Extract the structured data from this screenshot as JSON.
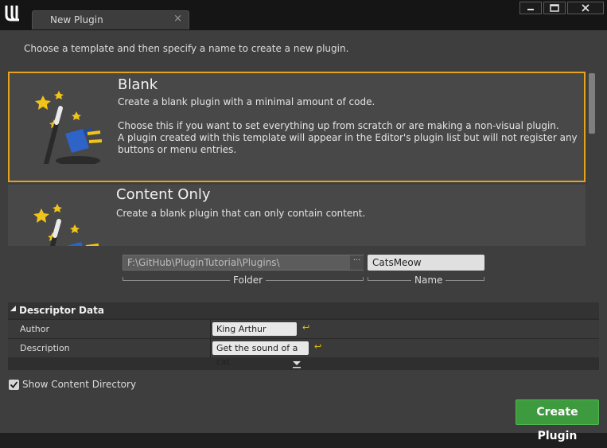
{
  "window": {
    "tab_title": "New Plugin",
    "tab_close_glyph": "×",
    "buttons": [
      "minimize-icon",
      "maximize-icon",
      "close-icon"
    ]
  },
  "intro": "Choose a template and then specify a name to create a new plugin.",
  "templates": [
    {
      "title": "Blank",
      "selected": true,
      "icon": "magic-wand-plug-icon",
      "description": [
        "Create a blank plugin with a minimal amount of code.",
        "Choose this if you want to set everything up from scratch or are making a non-visual plugin.\nA plugin created with this template will appear in the Editor's plugin list but will not register any buttons or menu entries."
      ]
    },
    {
      "title": "Content Only",
      "selected": false,
      "icon": "magic-wand-plug-icon",
      "description": [
        "Create a blank plugin that can only contain content."
      ]
    }
  ],
  "paths": {
    "folder_value": "F:\\GitHub\\PluginTutorial\\Plugins\\",
    "folder_label": "Folder",
    "browse_glyph": "···",
    "name_value": "CatsMeow",
    "name_label": "Name"
  },
  "descriptor": {
    "title": "Descriptor Data",
    "rows": [
      {
        "key": "Author",
        "value": "King Arthur"
      },
      {
        "key": "Description",
        "value": "Get the sound of a cat"
      }
    ],
    "reset_glyph": "↩"
  },
  "options": {
    "show_content_directory_label": "Show Content Directory",
    "show_content_directory_checked": true
  },
  "create_button_label": "Create Plugin",
  "colors": {
    "accent_selected": "#e6a21a",
    "create_button": "#3e9a3e",
    "reset_arrow": "#e6c200"
  }
}
